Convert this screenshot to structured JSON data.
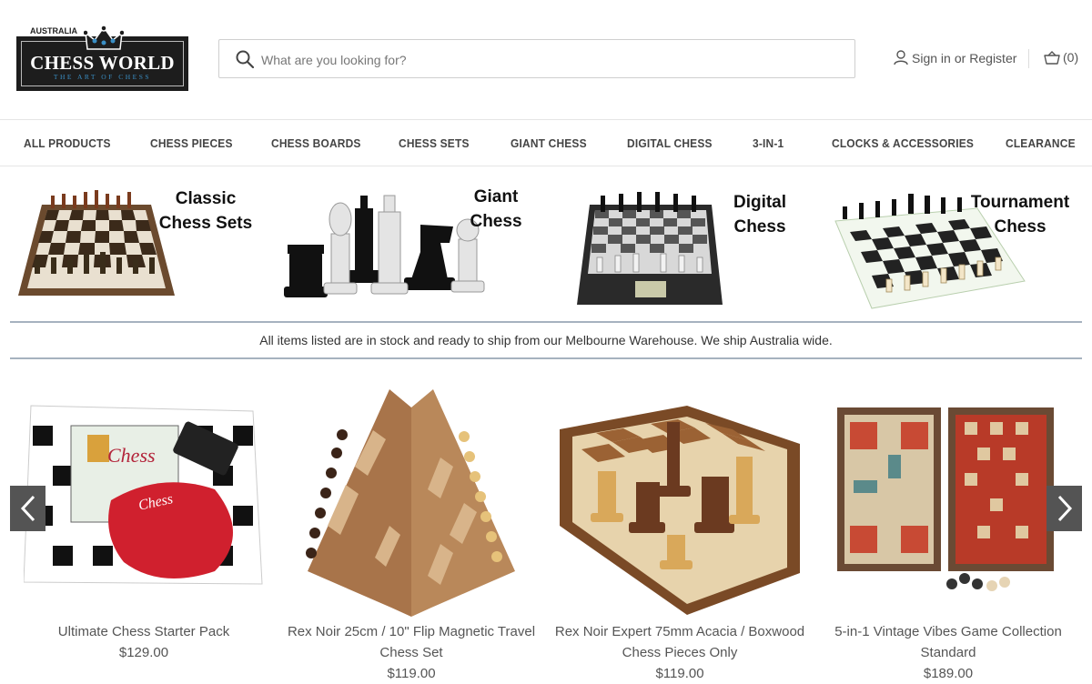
{
  "logo": {
    "top_word": "AUSTRALIA",
    "main_word": "CHESS WORLD",
    "sub_word": "THE ART OF CHESS"
  },
  "search": {
    "placeholder": "What are you looking for?",
    "icon": "search-icon"
  },
  "account": {
    "sign_in": "Sign in",
    "or": "or",
    "register": "Register",
    "icon": "user-icon"
  },
  "cart": {
    "count": "(0)",
    "icon": "basket-icon"
  },
  "nav": [
    "ALL PRODUCTS",
    "CHESS PIECES",
    "CHESS BOARDS",
    "CHESS SETS",
    "GIANT CHESS",
    "DIGITAL CHESS",
    "3-IN-1",
    "CLOCKS & ACCESSORIES",
    "CLEARANCE"
  ],
  "categories": [
    {
      "line1": "Classic",
      "line2": "Chess Sets"
    },
    {
      "line1": "Giant",
      "line2": "Chess"
    },
    {
      "line1": "Digital",
      "line2": "Chess"
    },
    {
      "line1": "Tournament",
      "line2": "Chess"
    }
  ],
  "notice": "All items listed are in stock and ready to ship from our Melbourne Warehouse. We ship Australia wide.",
  "products": [
    {
      "name": "Ultimate Chess Starter Pack",
      "price": "$129.00"
    },
    {
      "name": "Rex Noir 25cm / 10\" Flip Magnetic Travel Chess Set",
      "price": "$119.00"
    },
    {
      "name": "Rex Noir Expert 75mm Acacia / Boxwood Chess Pieces Only",
      "price": "$119.00"
    },
    {
      "name": "5-in-1 Vintage Vibes Game Collection Standard",
      "price": "$189.00"
    }
  ],
  "product_image_labels": {
    "book_title": "Chess",
    "bag_label": "Chess"
  },
  "carousel": {
    "prev_icon": "chevron-left-icon",
    "next_icon": "chevron-right-icon"
  },
  "colors": {
    "accent_rule": "#a6b2bf",
    "arrow_bg": "#545454",
    "logo_blue": "#3a8fc5"
  }
}
